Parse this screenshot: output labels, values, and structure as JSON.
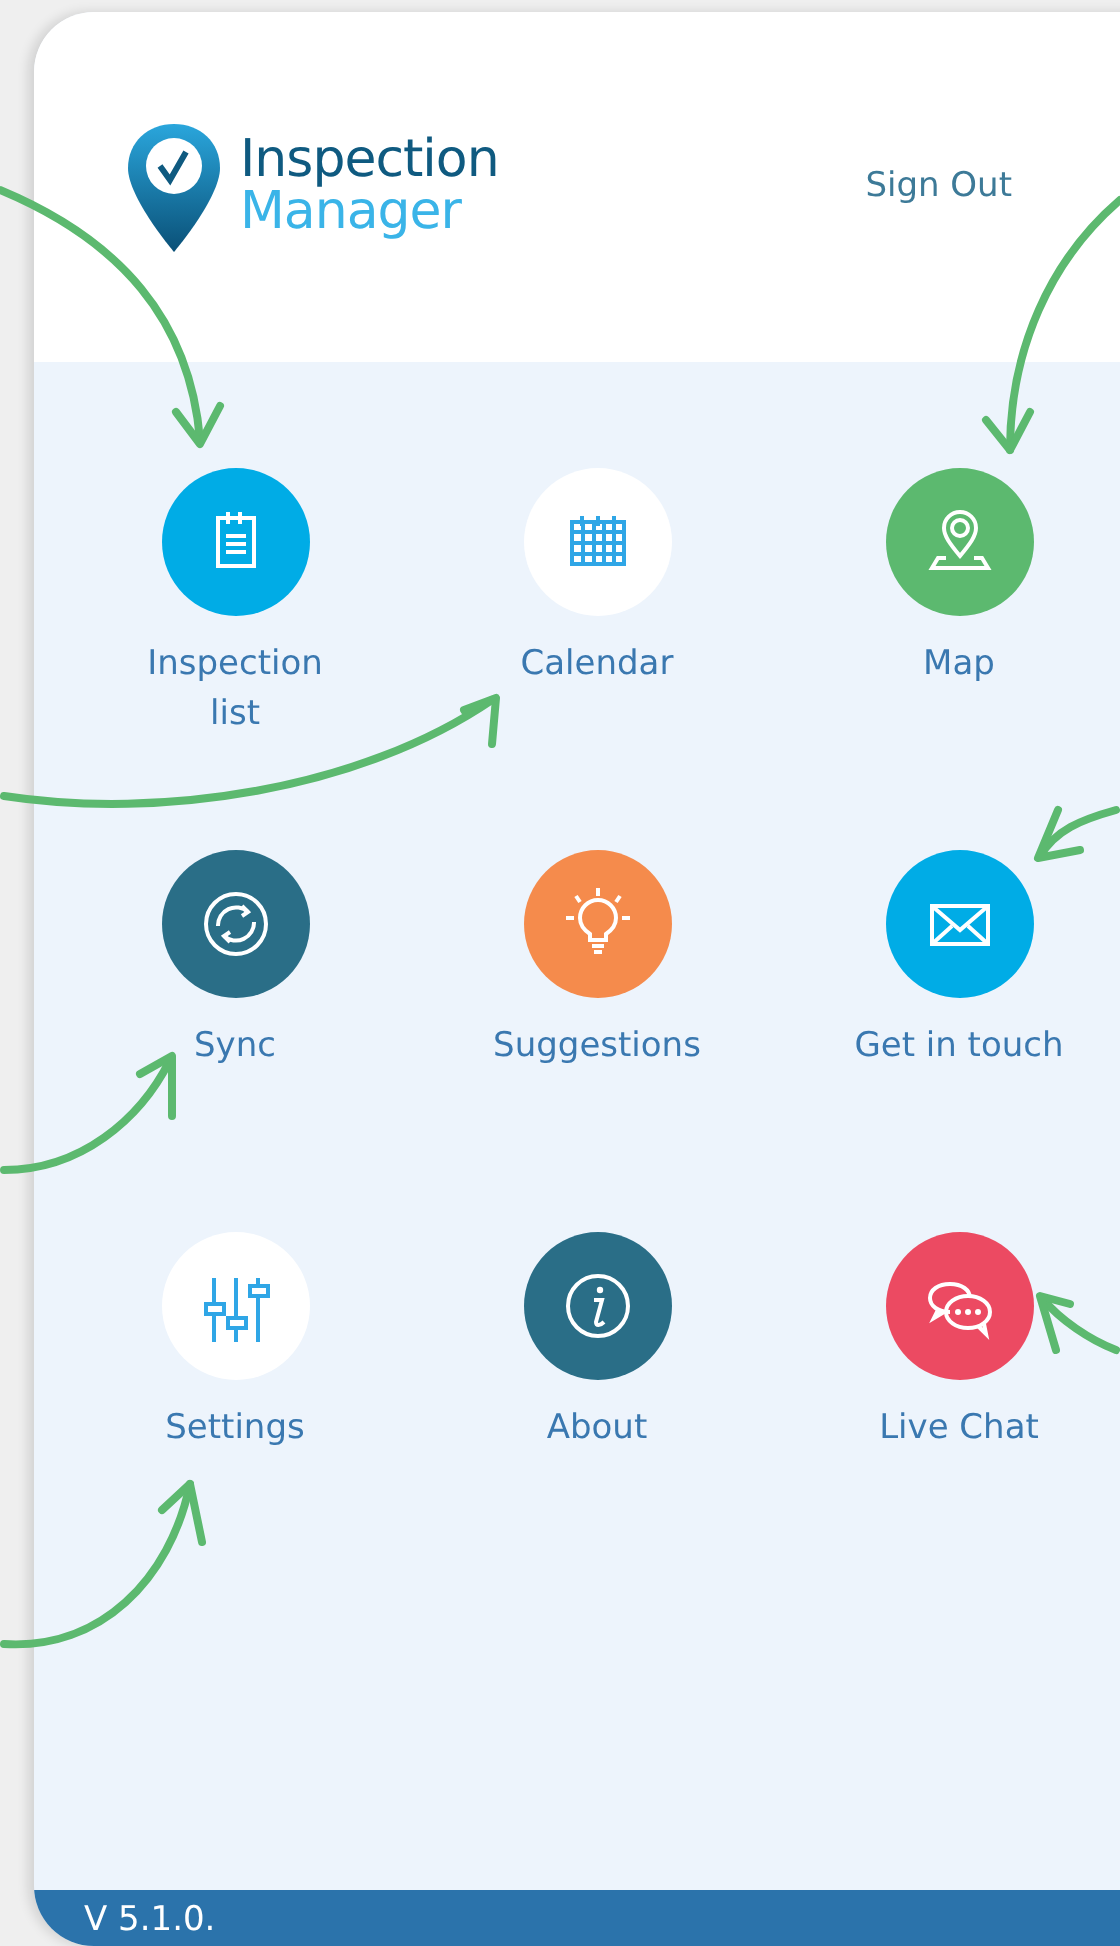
{
  "header": {
    "logo": {
      "line_1": "Inspection",
      "line_2": "Manager"
    },
    "sign_out": "Sign Out"
  },
  "menu": [
    {
      "label": "Inspection list",
      "kind": "clipboard",
      "color": "#00ace6"
    },
    {
      "label": "Calendar",
      "kind": "calendar",
      "color": "#ffffff"
    },
    {
      "label": "Map",
      "kind": "map",
      "color": "#5cb96f"
    },
    {
      "label": "Sync",
      "kind": "sync",
      "color": "#2a6e87"
    },
    {
      "label": "Suggestions",
      "kind": "bulb",
      "color": "#f58b4c"
    },
    {
      "label": "Get in touch",
      "kind": "mail",
      "color": "#00ace6"
    },
    {
      "label": "Settings",
      "kind": "sliders",
      "color": "#ffffff"
    },
    {
      "label": "About",
      "kind": "info",
      "color": "#2a6e87"
    },
    {
      "label": "Live Chat",
      "kind": "chat",
      "color": "#ec4a62"
    }
  ],
  "footer": {
    "version": "V 5.1.0."
  }
}
